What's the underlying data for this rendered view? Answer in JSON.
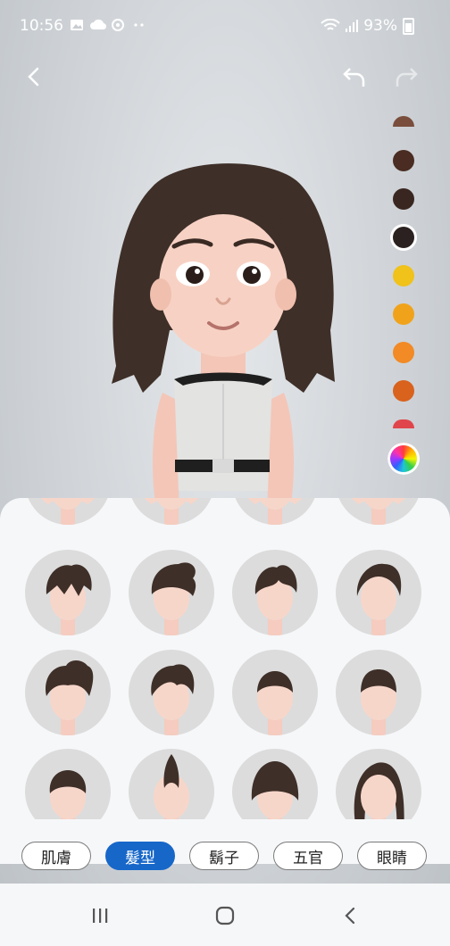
{
  "status_bar": {
    "time": "10:56",
    "battery": "93%",
    "icons": [
      "gallery-icon",
      "cloud-icon",
      "sync-icon",
      "more-dots-icon",
      "wifi-icon",
      "signal-icon",
      "battery-icon"
    ]
  },
  "toolbar": {
    "back_icon": "chevron-left-icon",
    "undo_icon": "undo-icon",
    "redo_icon": "redo-icon"
  },
  "colors": {
    "background": "#c9cdd1",
    "accent": "#1767c9",
    "hair": "#3e2f28"
  },
  "hair_color_swatches": [
    {
      "color": "#7a4e3c",
      "selected": false
    },
    {
      "color": "#4a2c22",
      "selected": false
    },
    {
      "color": "#3a2620",
      "selected": false
    },
    {
      "color": "#2a2120",
      "selected": true
    },
    {
      "color": "#f0c21a",
      "selected": false
    },
    {
      "color": "#f0a31a",
      "selected": false
    },
    {
      "color": "#f28a25",
      "selected": false
    },
    {
      "color": "#d9621d",
      "selected": false
    },
    {
      "color": "#e0454b",
      "selected": false
    }
  ],
  "custom_color_icon": "color-wheel-icon",
  "hairstyles": [
    {
      "style": "partial-top"
    },
    {
      "style": "partial-top"
    },
    {
      "style": "partial-top"
    },
    {
      "style": "partial-top"
    },
    {
      "style": "messy-fringe"
    },
    {
      "style": "quiff"
    },
    {
      "style": "textured-crop"
    },
    {
      "style": "slick-back"
    },
    {
      "style": "spiky-quiff"
    },
    {
      "style": "wavy-quiff"
    },
    {
      "style": "short-crop"
    },
    {
      "style": "flat-top"
    },
    {
      "style": "short-curls"
    },
    {
      "style": "mohawk"
    },
    {
      "style": "bowl-cut"
    },
    {
      "style": "long-hair"
    }
  ],
  "tabs": [
    {
      "label": "肌膚",
      "active": false
    },
    {
      "label": "髮型",
      "active": true
    },
    {
      "label": "鬍子",
      "active": false
    },
    {
      "label": "五官",
      "active": false
    },
    {
      "label": "眼睛",
      "active": false
    }
  ],
  "navbar": {
    "recents_icon": "recents-icon",
    "home_icon": "home-icon",
    "back_icon": "back-nav-icon"
  }
}
